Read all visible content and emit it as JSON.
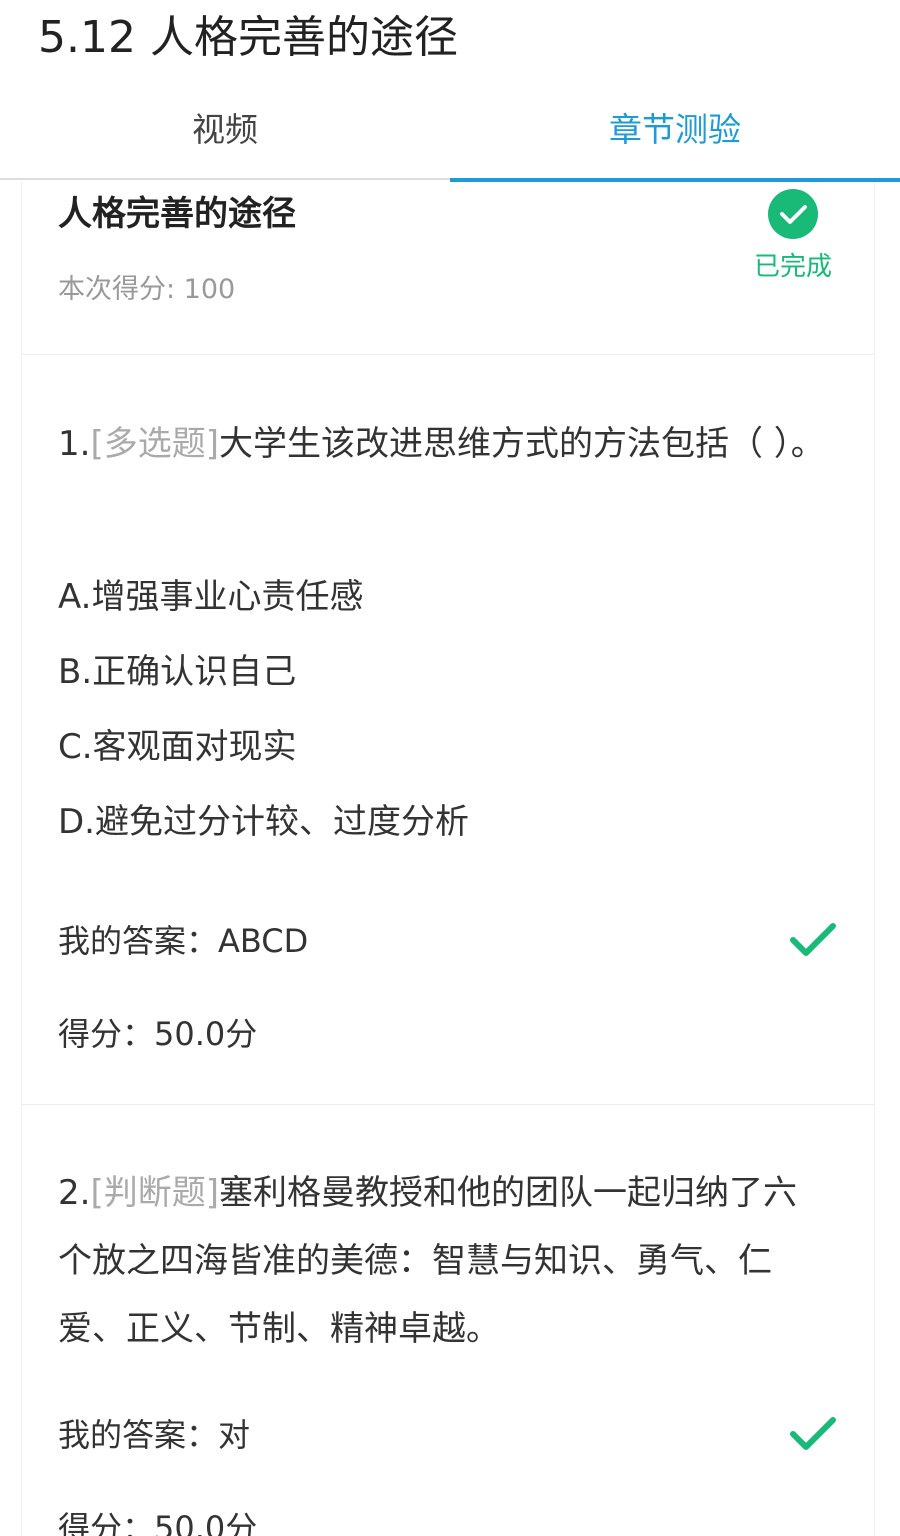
{
  "page_title": "5.12 人格完善的途径",
  "tabs": [
    {
      "label": "视频",
      "active": false
    },
    {
      "label": "章节测验",
      "active": true
    }
  ],
  "accent_color": "#1e9bd7",
  "success_color": "#19b978",
  "summary": {
    "title": "人格完善的途径",
    "score_text": "本次得分: 100",
    "status_label": "已完成",
    "status_icon": "check-circle-icon"
  },
  "questions": [
    {
      "number": "1.",
      "type": "[多选题]",
      "text": "大学生该改进思维方式的方法包括（ ）。",
      "options": [
        "A.增强事业心责任感",
        "B.正确认识自己",
        "C.客观面对现实",
        "D.避免过分计较、过度分析"
      ],
      "answer_label": "我的答案：",
      "answer": "ABCD",
      "score_label": "得分：",
      "score": "50.0分",
      "correct_icon": "check-icon"
    },
    {
      "number": "2.",
      "type": "[判断题]",
      "text": "塞利格曼教授和他的团队一起归纳了六个放之四海皆准的美德：智慧与知识、勇气、仁爱、正义、节制、精神卓越。",
      "answer_label": "我的答案：",
      "answer": "对",
      "score_label": "得分：",
      "score": "50.0分",
      "correct_icon": "check-icon"
    }
  ]
}
